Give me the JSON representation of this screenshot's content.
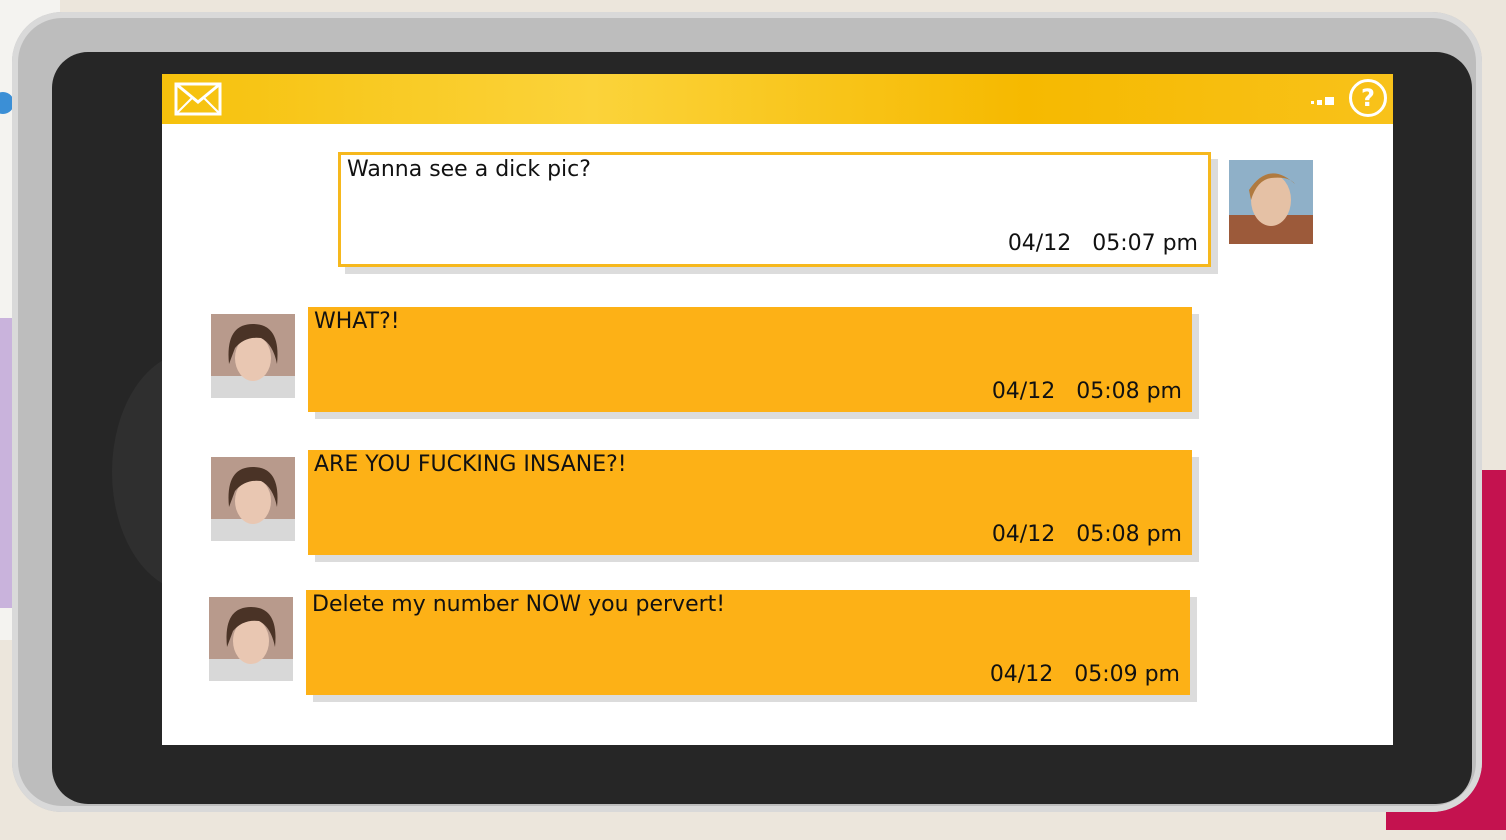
{
  "header": {
    "mail_icon": "envelope-icon",
    "signal_icon": "signal-icon",
    "help_icon": "help-icon",
    "help_glyph": "?"
  },
  "messages": [
    {
      "direction": "from-contact",
      "text": "Wanna see a dick pic?",
      "date": "04/12",
      "time": "05:07 pm"
    },
    {
      "direction": "from-player",
      "text": "WHAT?!",
      "date": "04/12",
      "time": "05:08 pm"
    },
    {
      "direction": "from-player",
      "text": "ARE YOU FUCKING INSANE?!",
      "date": "04/12",
      "time": "05:08 pm"
    },
    {
      "direction": "from-player",
      "text": "Delete my number NOW you pervert!",
      "date": "04/12",
      "time": "05:09 pm"
    }
  ],
  "colors": {
    "accent": "#fdb116",
    "header": "#f6c10c",
    "bezel": "#262626"
  }
}
